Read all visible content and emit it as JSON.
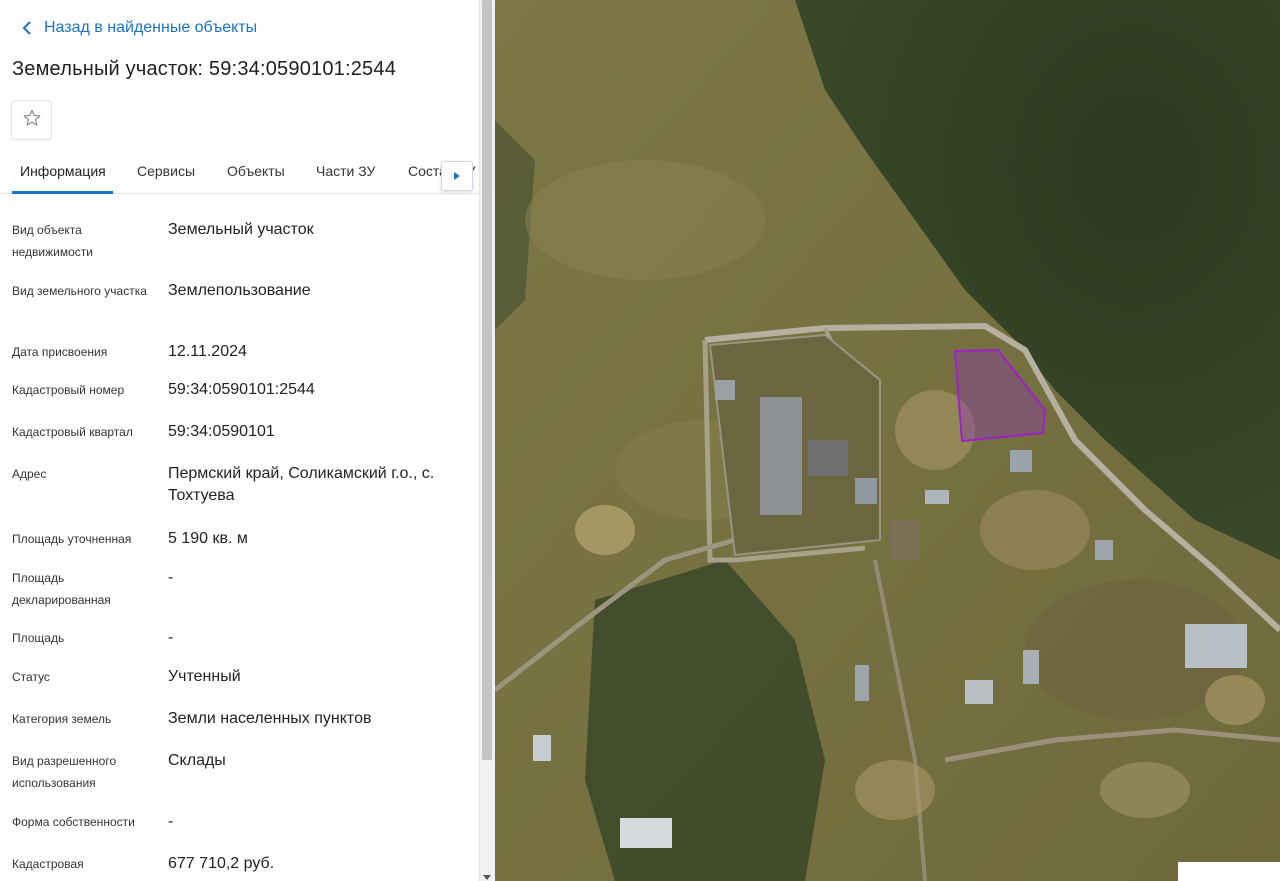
{
  "nav": {
    "back_label": "Назад в найденные объекты"
  },
  "header": {
    "title": "Земельный участок: 59:34:0590101:2544"
  },
  "tabs": [
    {
      "label": "Информация",
      "active": true
    },
    {
      "label": "Сервисы",
      "active": false
    },
    {
      "label": "Объекты",
      "active": false
    },
    {
      "label": "Части ЗУ",
      "active": false
    },
    {
      "label": "Состав ЗУ",
      "active": false
    }
  ],
  "info": [
    {
      "label": "Вид объекта недвижимости",
      "value": "Земельный участок"
    },
    {
      "label": "Вид земельного участка",
      "value": "Землепользование"
    },
    {
      "label": "Дата присвоения",
      "value": "12.11.2024"
    },
    {
      "label": "Кадастровый номер",
      "value": "59:34:0590101:2544"
    },
    {
      "label": "Кадастровый квартал",
      "value": "59:34:0590101"
    },
    {
      "label": "Адрес",
      "value": "Пермский край, Соликамский г.о., с. Тохтуева"
    },
    {
      "label": "Площадь уточненная",
      "value": "5 190 кв. м"
    },
    {
      "label": "Площадь декларированная",
      "value": "-"
    },
    {
      "label": "Площадь",
      "value": "-"
    },
    {
      "label": "Статус",
      "value": "Учтенный"
    },
    {
      "label": "Категория земель",
      "value": "Земли населенных пунктов"
    },
    {
      "label": "Вид разрешенного использования",
      "value": "Склады"
    },
    {
      "label": "Форма собственности",
      "value": "-"
    },
    {
      "label": "Кадастровая",
      "value": "677 710,2 руб."
    }
  ],
  "icons": {
    "back": "chevron-left-icon",
    "favorite": "star-outline-icon",
    "tabs_next": "caret-right-icon"
  },
  "colors": {
    "accent": "#1a73c8",
    "parcel_outline": "#a020c8",
    "parcel_fill": "#8a3fa0"
  },
  "map": {
    "type": "satellite",
    "highlighted_parcel": "59:34:0590101:2544"
  }
}
